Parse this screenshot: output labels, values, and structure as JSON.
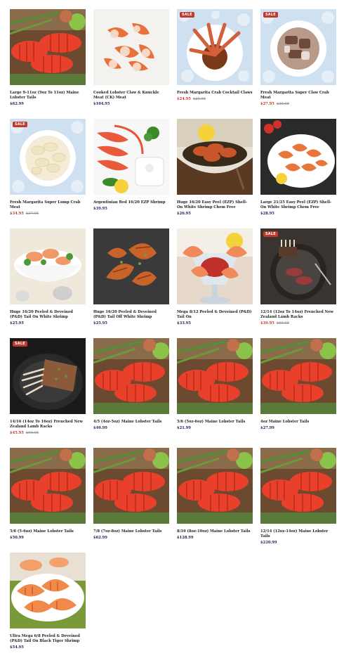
{
  "products": [
    {
      "name": "Large 9-11oz (9oz To 11oz) Maine Lobster Tails",
      "price": "$62.99",
      "old_price": "",
      "sale": "",
      "img": "lobster-tails"
    },
    {
      "name": "Cooked Lobster Claw & Knuckle Meat (CK) Meat",
      "price": "$104.95",
      "old_price": "",
      "sale": "",
      "img": "claw-meat"
    },
    {
      "name": "Fresh Margarita Crab Cocktail Claws",
      "price": "$24.95",
      "old_price": "$29.95",
      "sale": "SALE",
      "img": "crab-claws"
    },
    {
      "name": "Fresh Margarita Super Claw Crab Meat",
      "price": "$27.95",
      "old_price": "$30.95",
      "sale": "SALE",
      "img": "claw-crab-meat"
    },
    {
      "name": "Fresh Margarita Super Lump Crab Meat",
      "price": "$34.95",
      "old_price": "$37.95",
      "sale": "SALE",
      "img": "lump-crab-meat"
    },
    {
      "name": "Argentinian Red 16/20 EZP Shrimp",
      "price": "$39.95",
      "old_price": "",
      "sale": "",
      "img": "red-shrimp"
    },
    {
      "name": "Huge 16/20 Easy Peel (EZP) Shell-On White Shrimp Chem Free",
      "price": "$26.95",
      "old_price": "",
      "sale": "",
      "img": "bowl-shrimp"
    },
    {
      "name": "Large 21/25 Easy Peel (EZP) Shell-On White Shrimp Chem Free",
      "price": "$28.95",
      "old_price": "",
      "sale": "",
      "img": "plate-shrimp"
    },
    {
      "name": "Huge 16/20 Peeled & Deveined (P&D) Tail On White Shrimp",
      "price": "$25.95",
      "old_price": "",
      "sale": "",
      "img": "shrimp-salad"
    },
    {
      "name": "Huge 16/20 Peeled & Deveined (P&D) Tail Off White Shrimp",
      "price": "$25.95",
      "old_price": "",
      "sale": "",
      "img": "grilled-shrimp"
    },
    {
      "name": "Mega 8/12 Peeled & Deveined (P&D) Tail On",
      "price": "$33.95",
      "old_price": "",
      "sale": "",
      "img": "shrimp-cocktail"
    },
    {
      "name": "12/14 (12oz To 14oz) Frenched New Zealand Lamb Racks",
      "price": "$39.95",
      "old_price": "$69.95",
      "sale": "SALE",
      "img": "lamb-plate"
    },
    {
      "name": "14/16 (14oz To 16oz) Frenched New Zealand Lamb Racks",
      "price": "$45.95",
      "old_price": "$69.95",
      "sale": "SALE",
      "img": "lamb-rack"
    },
    {
      "name": "4/5 (4oz-5oz) Maine Lobster Tails",
      "price": "$40.99",
      "old_price": "",
      "sale": "",
      "img": "lobster-tails"
    },
    {
      "name": "5/6 (5oz-6oz) Maine Lobster Tails",
      "price": "$21.99",
      "old_price": "",
      "sale": "",
      "img": "lobster-tails"
    },
    {
      "name": "4oz Maine Lobster Tails",
      "price": "$27.99",
      "old_price": "",
      "sale": "",
      "img": "lobster-tails"
    },
    {
      "name": "5/6 (5-6oz) Maine Lobster Tails",
      "price": "$50.99",
      "old_price": "",
      "sale": "",
      "img": "lobster-tails"
    },
    {
      "name": "7/8 (7oz-8oz) Maine Lobster Tails",
      "price": "$62.99",
      "old_price": "",
      "sale": "",
      "img": "lobster-tails"
    },
    {
      "name": "8/10 (8oz-10oz) Maine Lobster Tails",
      "price": "$128.99",
      "old_price": "",
      "sale": "",
      "img": "lobster-tails"
    },
    {
      "name": "12/14 (12oz-14oz) Maine Lobster Tails",
      "price": "$220.99",
      "old_price": "",
      "sale": "",
      "img": "lobster-tails"
    },
    {
      "name": "Ultra Mega 6/8 Peeled & Deveined (P&D) Tail On Black Tiger Shrimp",
      "price": "$54.95",
      "old_price": "",
      "sale": "",
      "img": "tiger-shrimp"
    }
  ],
  "colors": {
    "sale": "#c0392b",
    "price": "#1a1a5e"
  }
}
